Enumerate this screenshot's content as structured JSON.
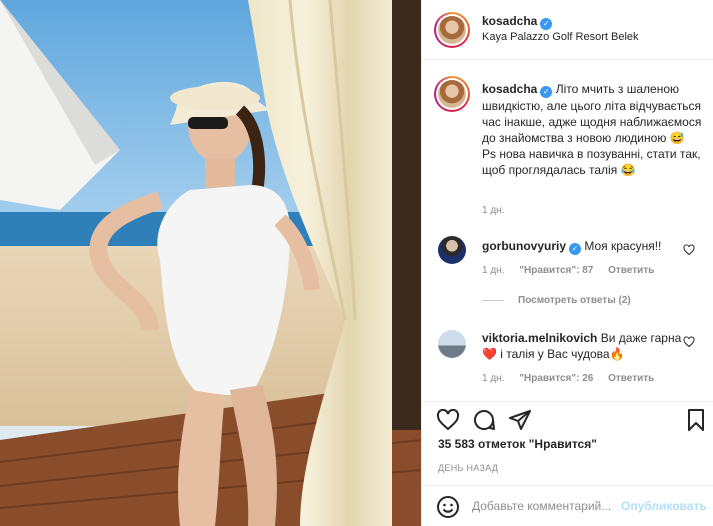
{
  "post": {
    "username": "kosadcha",
    "location": "Kaya Palazzo Golf Resort Belek"
  },
  "caption": {
    "username": "kosadcha",
    "text": "Літо мчить з шаленою швидкістю, але цього літа відчувається час інакше, адже щодня наближаємося до знайомства з новою людиною 😅",
    "text2": "Ps нова навичка в позуванні, стати так, щоб проглядалась талія 😂",
    "time": "1 дн."
  },
  "comments": [
    {
      "username": "gorbunovyuriy",
      "verified": true,
      "text": "Моя красуня!!",
      "time": "1 дн.",
      "likes": "\"Нравится\": 87",
      "reply": "Ответить"
    },
    {
      "username": "viktoria.melnikovich",
      "verified": false,
      "text": "Ви даже гарна❤️ і талія у Вас чудова🔥",
      "time": "1 дн.",
      "likes": "\"Нравится\": 26",
      "reply": "Ответить"
    }
  ],
  "view_replies": "Посмотреть ответы (2)",
  "likes_count": "35 583 отметок \"Нравится\"",
  "posted_ago": "ДЕНЬ НАЗАД",
  "add_comment": {
    "placeholder": "Добавьте комментарий...",
    "publish_label": "Опубликовать"
  },
  "icons": {
    "like": "heart-icon",
    "comment": "comment-icon",
    "share": "share-icon",
    "save": "bookmark-icon",
    "emoji": "emoji-icon"
  },
  "colors": {
    "verified": "#3897f0",
    "muted": "#8e8e8e",
    "publish_disabled": "#b2dffc"
  }
}
